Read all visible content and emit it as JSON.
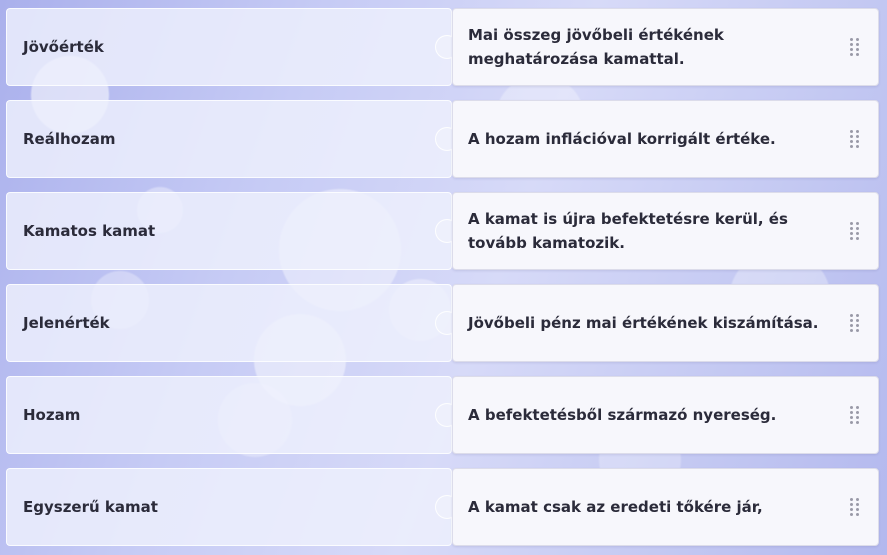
{
  "pairs": [
    {
      "term": "Jövőérték",
      "definition": "Mai összeg jövőbeli értékének meghatározása kamattal."
    },
    {
      "term": "Reálhozam",
      "definition": "A hozam inflációval korrigált értéke."
    },
    {
      "term": "Kamatos kamat",
      "definition": "A kamat is újra befektetésre kerül, és tovább kamatozik."
    },
    {
      "term": "Jelenérték",
      "definition": "Jövőbeli pénz mai értékének kiszámítása."
    },
    {
      "term": "Hozam",
      "definition": "A befektetésből származó nyereség."
    },
    {
      "term": "Egyszerű kamat",
      "definition": "A kamat csak az eredeti tőkére jár,"
    }
  ],
  "icons": {
    "drag_handle": "drag-handle-icon"
  }
}
